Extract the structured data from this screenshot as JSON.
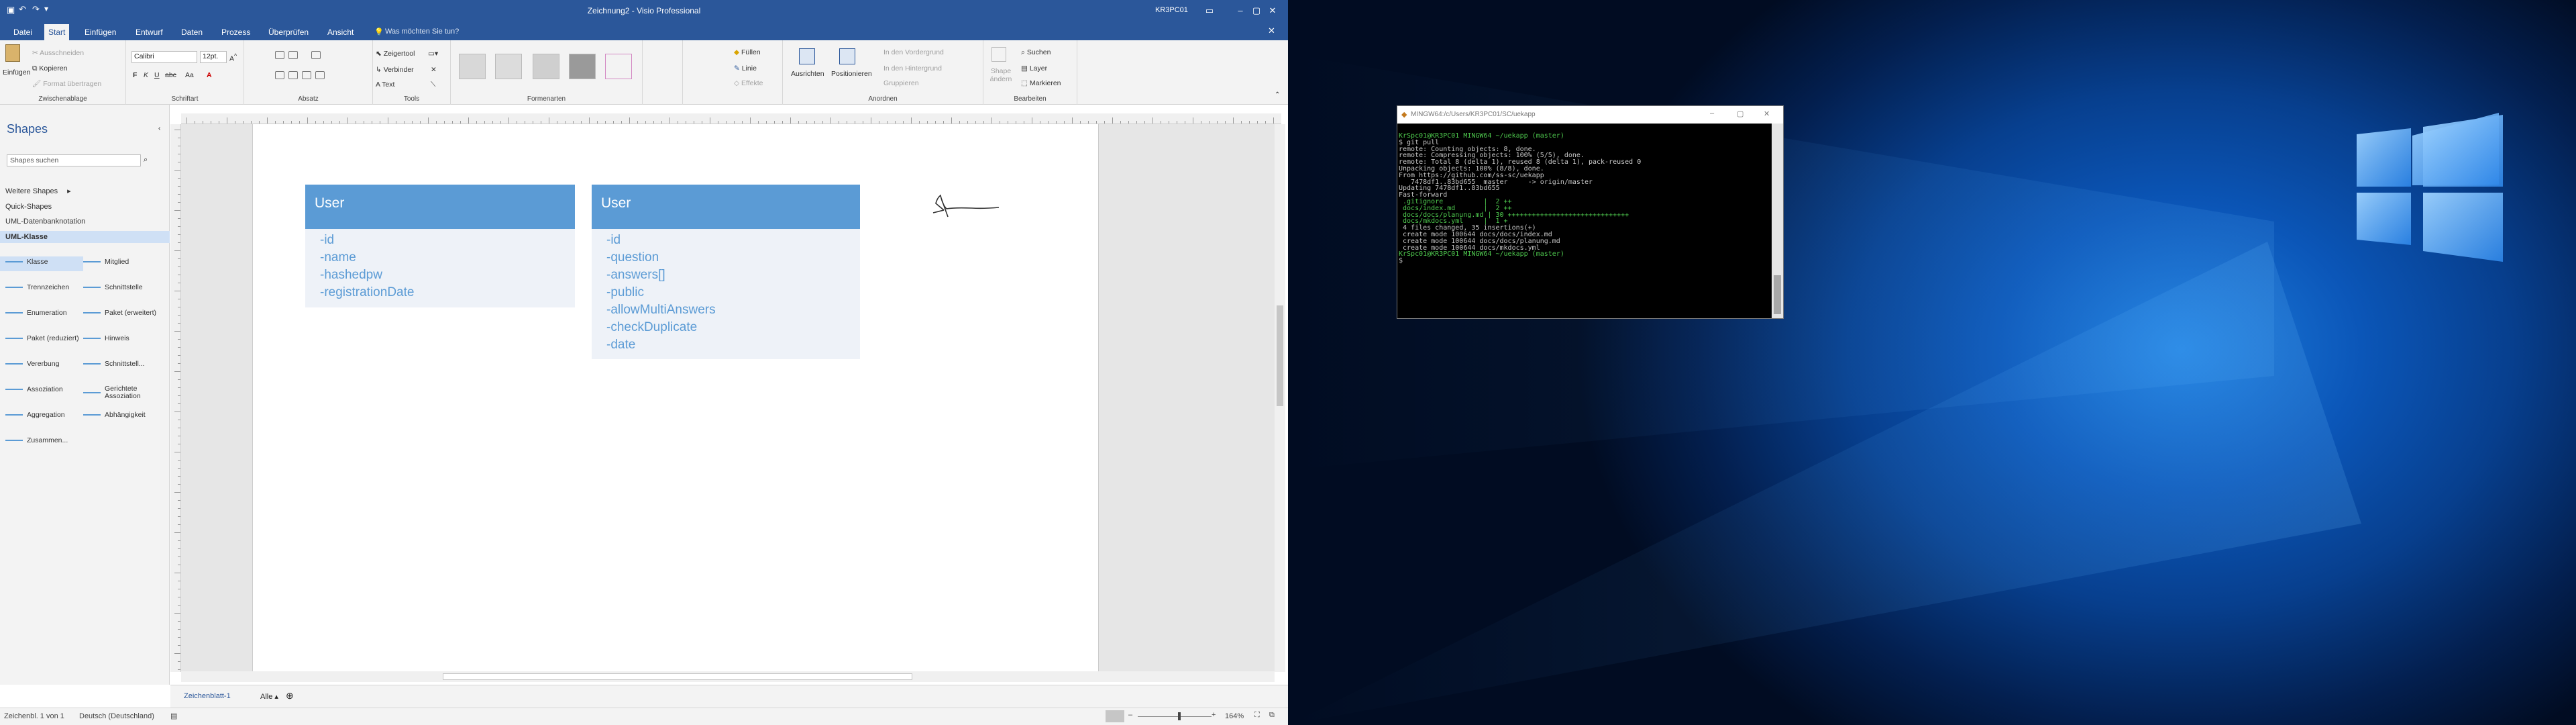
{
  "app": {
    "title": "Zeichnung2  -  Visio Professional",
    "user": "KR3PC01"
  },
  "tabs": [
    "Datei",
    "Start",
    "Einfügen",
    "Entwurf",
    "Daten",
    "Prozess",
    "Überprüfen",
    "Ansicht"
  ],
  "tellme": "Was möchten Sie tun?",
  "ribbon": {
    "clipboard": {
      "paste": "Einfügen",
      "cut": "Ausschneiden",
      "copy": "Kopieren",
      "format": "Format übertragen",
      "label": "Zwischenablage"
    },
    "font": {
      "name": "Calibri",
      "size": "12pt.",
      "label": "Schriftart"
    },
    "paragraph": {
      "label": "Absatz"
    },
    "tools": {
      "pointer": "Zeigertool",
      "connector": "Verbinder",
      "text": "Text",
      "label": "Tools"
    },
    "styles": {
      "label": "Formenarten",
      "fill": "Füllen",
      "line": "Linie",
      "effects": "Effekte"
    },
    "arrange": {
      "align": "Ausrichten",
      "position": "Positionieren",
      "front": "In den Vordergrund",
      "back": "In den Hintergrund",
      "group": "Gruppieren",
      "label": "Anordnen"
    },
    "edit": {
      "shapechange": "Shape ändern",
      "search": "Suchen",
      "layer": "Layer",
      "select": "Markieren",
      "label": "Bearbeiten"
    }
  },
  "shapes": {
    "title": "Shapes",
    "search_placeholder": "Shapes suchen",
    "more": "Weitere Shapes",
    "quick": "Quick-Shapes",
    "annotation": "UML-Datenbanknotation",
    "uml": "UML-Klasse",
    "stencils": [
      [
        "Klasse",
        "Mitglied"
      ],
      [
        "Trennzeichen",
        "Schnittstelle"
      ],
      [
        "Enumeration",
        "Paket (erweitert)"
      ],
      [
        "Paket (reduziert)",
        "Hinweis"
      ],
      [
        "Vererbung",
        "Schnittstell..."
      ],
      [
        "Assoziation",
        "Gerichtete Assoziation"
      ],
      [
        "Aggregation",
        "Abhängigkeit"
      ],
      [
        "Zusammen..."
      ]
    ]
  },
  "diagram": {
    "class1": {
      "name": "User",
      "attrs": [
        "-id",
        "-name",
        "-hashedpw",
        "-registrationDate"
      ]
    },
    "class2": {
      "name": "User",
      "attrs": [
        "-id",
        "-question",
        "-answers[]",
        "-public",
        "-allowMultiAnswers",
        "-checkDuplicate",
        "-date"
      ]
    }
  },
  "sheets": {
    "page": "Zeichenblatt-1",
    "all": "Alle"
  },
  "status": {
    "page": "Zeichenbl. 1 von 1",
    "lang": "Deutsch (Deutschland)",
    "zoom": "164%"
  },
  "terminal": {
    "title": "MINGW64:/c/Users/KR3PC01/SC/uekapp",
    "lines": [
      {
        "t": "KrSpc01@KR3PC01 MINGW64 ~/uekapp (master)",
        "k": "prompt"
      },
      {
        "t": "$ git pull",
        "k": ""
      },
      {
        "t": "remote: Counting objects: 8, done.",
        "k": ""
      },
      {
        "t": "remote: Compressing objects: 100% (5/5), done.",
        "k": ""
      },
      {
        "t": "remote: Total 8 (delta 1), reused 8 (delta 1), pack-reused 0",
        "k": ""
      },
      {
        "t": "Unpacking objects: 100% (8/8), done.",
        "k": ""
      },
      {
        "t": "From https://github.com/ss-sc/uekapp",
        "k": ""
      },
      {
        "t": "   7478df1..83bd655  master     -> origin/master",
        "k": ""
      },
      {
        "t": "Updating 7478df1..83bd655",
        "k": ""
      },
      {
        "t": "Fast-forward",
        "k": ""
      },
      {
        "t": " .gitignore          |  2 ++",
        "k": "diff"
      },
      {
        "t": " docs/index.md       |  2 ++",
        "k": "diff"
      },
      {
        "t": " docs/docs/planung.md | 30 ++++++++++++++++++++++++++++++",
        "k": "diff"
      },
      {
        "t": " docs/mkdocs.yml     |  1 +",
        "k": "diff"
      },
      {
        "t": " 4 files changed, 35 insertions(+)",
        "k": ""
      },
      {
        "t": " create mode 100644 docs/docs/index.md",
        "k": ""
      },
      {
        "t": " create mode 100644 docs/docs/planung.md",
        "k": ""
      },
      {
        "t": " create mode 100644 docs/mkdocs.yml",
        "k": ""
      },
      {
        "t": "",
        "k": ""
      },
      {
        "t": "KrSpc01@KR3PC01 MINGW64 ~/uekapp (master)",
        "k": "prompt"
      },
      {
        "t": "$ ",
        "k": ""
      }
    ]
  }
}
